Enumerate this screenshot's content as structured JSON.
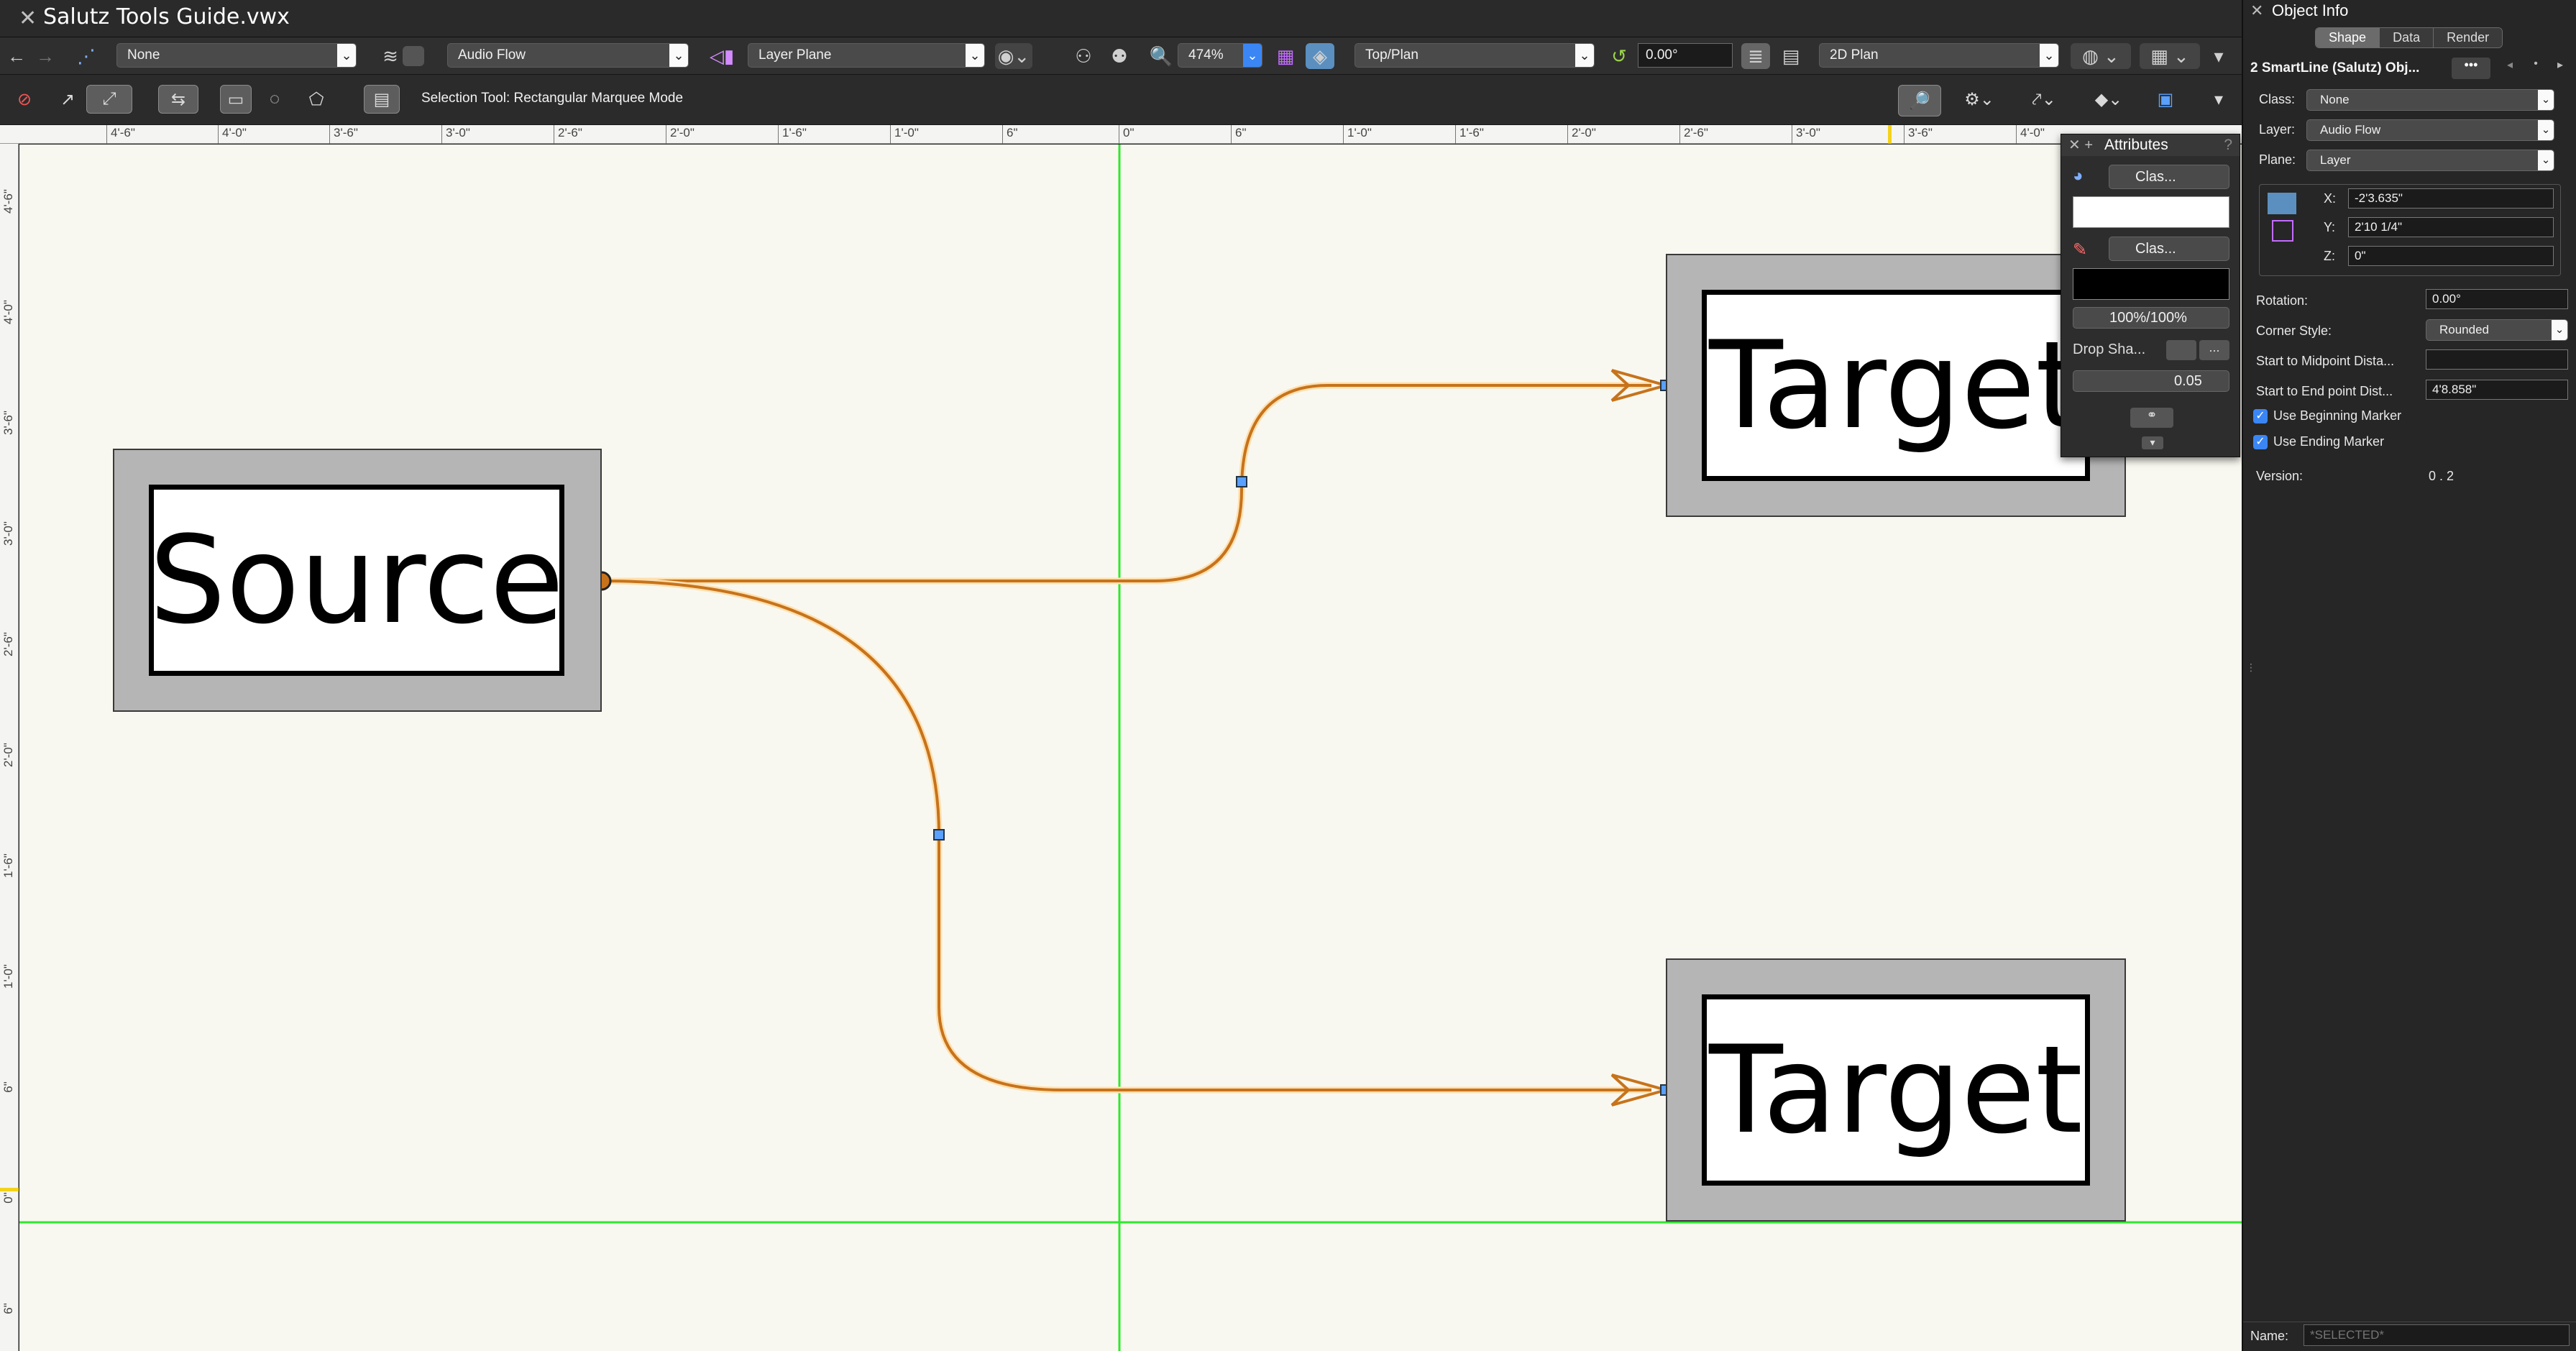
{
  "window": {
    "title": "Salutz Tools Guide.vwx"
  },
  "view_bar": {
    "class_dropdown": "None",
    "layer_dropdown": "Audio Flow",
    "plane_dropdown": "Layer Plane",
    "zoom": "474%",
    "view_dropdown": "Top/Plan",
    "rotation": "0.00°",
    "render_dropdown": "2D Plan"
  },
  "mode_bar": {
    "status_text": "Selection Tool: Rectangular Marquee Mode"
  },
  "rulers": {
    "horizontal": [
      "4'-6\"",
      "4'-0\"",
      "3'-6\"",
      "3'-0\"",
      "2'-6\"",
      "2'-0\"",
      "1'-6\"",
      "1'-0\"",
      "6\"",
      "0\"",
      "6\"",
      "1'-0\"",
      "1'-6\"",
      "2'-0\"",
      "2'-6\"",
      "3'-0\"",
      "3'-6\"",
      "4'-0\""
    ],
    "vertical": [
      "4'-6\"",
      "4'-0\"",
      "3'-6\"",
      "3'-0\"",
      "2'-6\"",
      "2'-0\"",
      "1'-6\"",
      "1'-0\"",
      "6\"",
      "0\"",
      "6\""
    ]
  },
  "drawing": {
    "source_label": "Source",
    "target_top_label": "Target",
    "target_bottom_label": "Target",
    "line_color": "#c7731b",
    "guide_color": "#2ee82e"
  },
  "attributes_palette": {
    "title": "Attributes",
    "fill_dropdown": "Clas...",
    "pen_dropdown": "Clas...",
    "opacity": "100%/100%",
    "drop_shadow_label": "Drop Sha...",
    "line_weight": "0.05"
  },
  "object_info": {
    "title": "Object Info",
    "tabs": [
      "Shape",
      "Data",
      "Render"
    ],
    "active_tab": "Shape",
    "object_title": "2 SmartLine (Salutz) Obj...",
    "class_label": "Class:",
    "class_value": "None",
    "layer_label": "Layer:",
    "layer_value": "Audio Flow",
    "plane_label": "Plane:",
    "plane_value": "Layer",
    "x_label": "X:",
    "x_value": "-2'3.635\"",
    "y_label": "Y:",
    "y_value": "2'10 1/4\"",
    "z_label": "Z:",
    "z_value": "0\"",
    "rotation_label": "Rotation:",
    "rotation_value": "0.00°",
    "corner_style_label": "Corner Style:",
    "corner_style_value": "Rounded",
    "start_mid_label": "Start to Midpoint Dista...",
    "start_mid_value": "",
    "start_end_label": "Start to End point Dist...",
    "start_end_value": "4'8.858\"",
    "use_beginning_marker": "Use Beginning Marker",
    "use_ending_marker": "Use Ending Marker",
    "version_label": "Version:",
    "version_value": "0 . 2",
    "name_label": "Name:",
    "name_placeholder": "*SELECTED*"
  }
}
